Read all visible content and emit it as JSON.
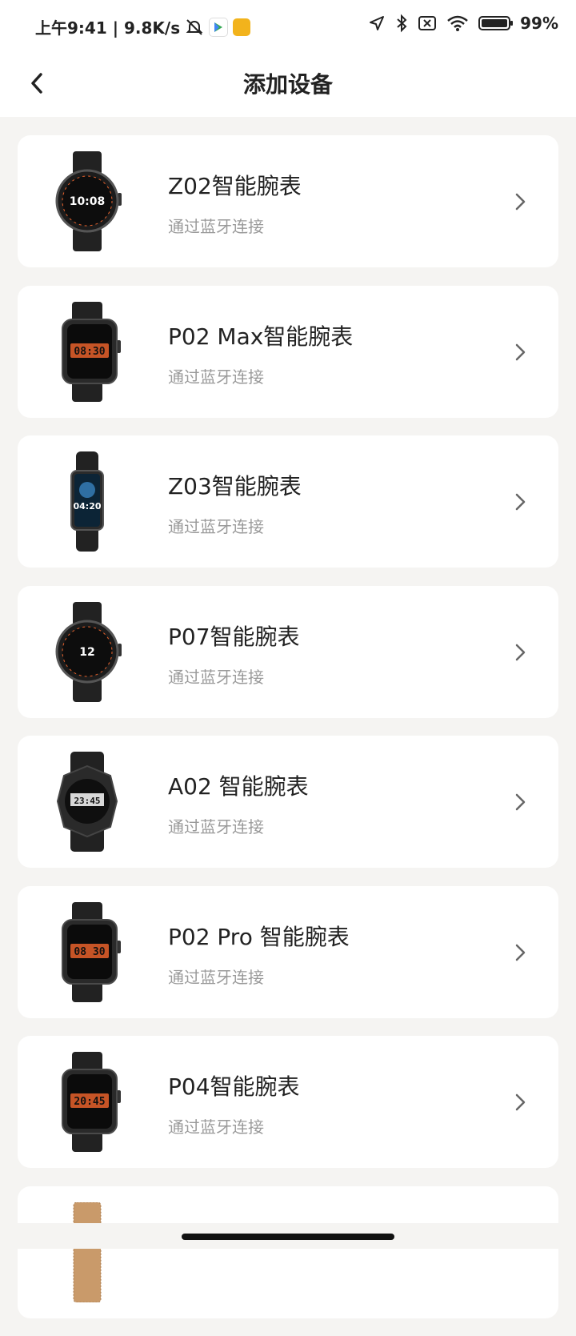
{
  "status_bar": {
    "time_speed": "上午9:41 | 9.8K/s",
    "battery_percent": "99%",
    "battery_level": 0.99,
    "icons": [
      "mute-bell-icon",
      "play-store-icon",
      "app-badge-icon",
      "location-icon",
      "bluetooth-icon",
      "no-sim-icon",
      "wifi-icon",
      "battery-icon"
    ]
  },
  "header": {
    "title": "添加设备",
    "back_icon": "chevron-left-icon"
  },
  "devices": [
    {
      "name": "Z02智能腕表",
      "subtitle": "通过蓝牙连接",
      "watch_shape": "round",
      "screen_text": "10:08"
    },
    {
      "name": "P02 Max智能腕表",
      "subtitle": "通过蓝牙连接",
      "watch_shape": "square",
      "screen_text": "08:30"
    },
    {
      "name": "Z03智能腕表",
      "subtitle": "通过蓝牙连接",
      "watch_shape": "band",
      "screen_text": "04:20"
    },
    {
      "name": "P07智能腕表",
      "subtitle": "通过蓝牙连接",
      "watch_shape": "round",
      "screen_text": "12"
    },
    {
      "name": "A02 智能腕表",
      "subtitle": "通过蓝牙连接",
      "watch_shape": "rugged",
      "screen_text": "23:45"
    },
    {
      "name": "P02 Pro 智能腕表",
      "subtitle": "通过蓝牙连接",
      "watch_shape": "square",
      "screen_text": "08 30"
    },
    {
      "name": "P04智能腕表",
      "subtitle": "通过蓝牙连接",
      "watch_shape": "square",
      "screen_text": "20:45"
    },
    {
      "name": "",
      "subtitle": "",
      "watch_shape": "mesh",
      "screen_text": ""
    }
  ],
  "colors": {
    "background": "#f5f4f2",
    "card": "#ffffff",
    "accent_orange": "#e8622c",
    "text_primary": "#222222",
    "text_secondary": "#9a9a9a"
  }
}
